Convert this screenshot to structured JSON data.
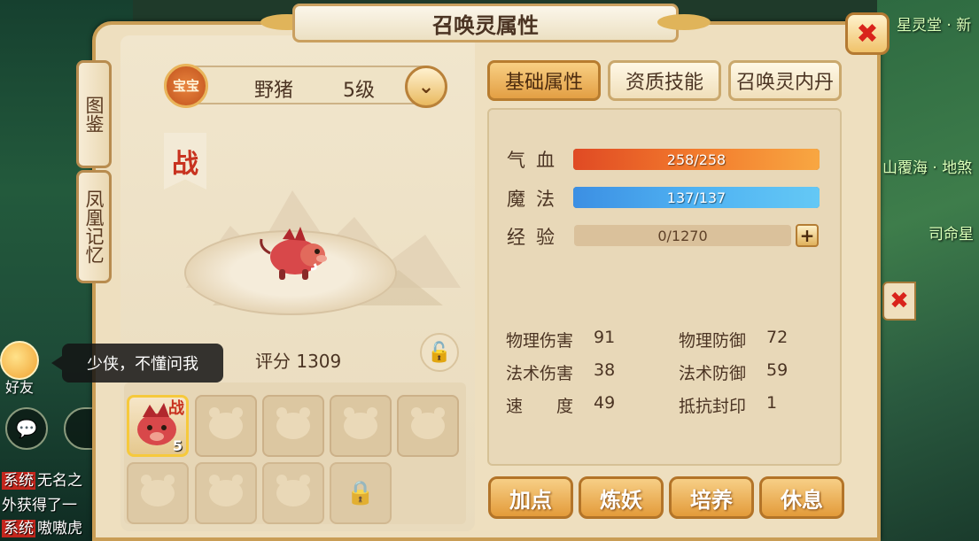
{
  "window": {
    "title": "召唤灵属性",
    "close_icon": "✖"
  },
  "side_tabs": [
    {
      "label": "图鉴"
    },
    {
      "label": "凤凰记忆"
    }
  ],
  "pet": {
    "badge": "宝宝",
    "name": "野猪",
    "level": "5级",
    "battle_flag": "战",
    "score_label": "评分",
    "score": "1309"
  },
  "tip": {
    "text": "少侠，不懂问我"
  },
  "background": {
    "right_texts": [
      "星灵堂 · 新",
      "山覆海 · 地煞",
      "司命星"
    ],
    "left_texts": [
      "好友"
    ],
    "chat": [
      {
        "tag": "系统",
        "text": "无名之"
      },
      {
        "tag": "",
        "text": "外获得了一"
      },
      {
        "tag": "系统",
        "text": "嗷嗷虎"
      }
    ]
  },
  "slots": {
    "selected_level": "5",
    "selected_badge": "战"
  },
  "tabs": [
    {
      "label": "基础属性",
      "active": true
    },
    {
      "label": "资质技能",
      "active": false
    },
    {
      "label": "召唤灵内丹",
      "active": false
    }
  ],
  "stats": {
    "hp": {
      "label": "气血",
      "value": "258/258",
      "fraction": 1.0
    },
    "mp": {
      "label": "魔法",
      "value": "137/137",
      "fraction": 1.0
    },
    "exp": {
      "label": "经验",
      "value": "0/1270",
      "fraction": 0.0
    },
    "exp_plus": "+"
  },
  "attributes": [
    {
      "label": "物理伤害",
      "value": "91"
    },
    {
      "label": "物理防御",
      "value": "72"
    },
    {
      "label": "法术伤害",
      "value": "38"
    },
    {
      "label": "法术防御",
      "value": "59"
    },
    {
      "label": "速　　度",
      "value": "49"
    },
    {
      "label": "抵抗封印",
      "value": "1"
    }
  ],
  "actions": [
    {
      "label": "加点"
    },
    {
      "label": "炼妖"
    },
    {
      "label": "培养"
    },
    {
      "label": "休息"
    }
  ],
  "colors": {
    "accent": "#e39b3a",
    "hp": "#e04a24",
    "mp": "#3c8fe3",
    "exp": "#c99f62"
  }
}
